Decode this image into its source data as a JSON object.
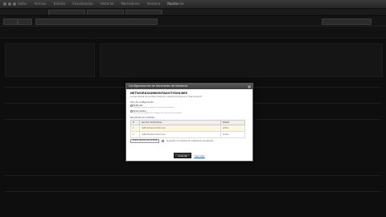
{
  "browser": {
    "menu": [
      "Safari",
      "Archivo",
      "Edición",
      "Visualización",
      "Historial",
      "Marcadores",
      "Ventana",
      "Ayuda"
    ],
    "window_title": "Hostname"
  },
  "modal": {
    "title": "Configuraciones de Servidores de Nombres",
    "close_symbol": "×",
    "heading": "NETWORKSAMBIENTADOTYDHLBEE",
    "description": "Los servidores de nombres traducen nombres de dominio a direcciones IP.",
    "config_label": "Tipo de configuración",
    "options": [
      {
        "label": "Estándar",
        "sub": "Hosting, servicio y correo en nuestros servidores.",
        "selected": true
      },
      {
        "label": "Personalizar",
        "sub": "Use otros servidores de nombres de forma personalizada.",
        "selected": false
      }
    ],
    "servers_label": "Servidores de nombres",
    "table": {
      "headers": [
        "#",
        "Servidor de Nombres",
        "Estado"
      ],
      "rows": [
        {
          "num": "1",
          "server": "ns05.domaincontrol.com",
          "status": "Activo"
        },
        {
          "num": "2",
          "server": "ns06.domaincontrol.com",
          "status": "Activo"
        }
      ]
    },
    "add_button": "Añadir servidor de nombres",
    "apply_note": "Al guardar, los cambios de configuración se aplicarán",
    "save_button": "Guardar",
    "cancel_link": "Cancelar"
  }
}
